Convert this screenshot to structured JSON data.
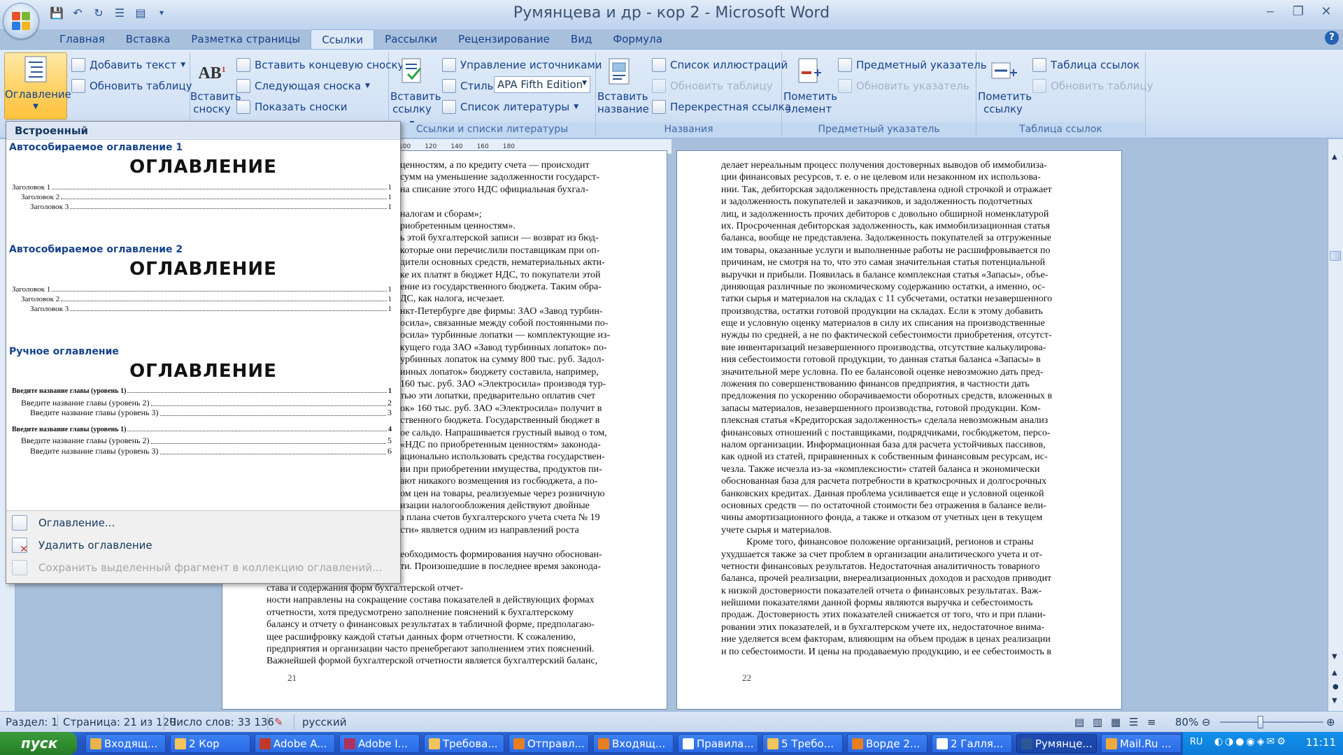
{
  "window": {
    "title": "Румянцева и др - кор 2 - Microsoft Word"
  },
  "tabs": [
    "Главная",
    "Вставка",
    "Разметка страницы",
    "Ссылки",
    "Рассылки",
    "Рецензирование",
    "Вид",
    "Формула"
  ],
  "active_tab": "Ссылки",
  "ribbon": {
    "toc_button": "Оглавление",
    "add_text": "Добавить текст",
    "update_table": "Обновить таблицу",
    "insert_footnote_1": "Вставить",
    "insert_footnote_2": "сноску",
    "insert_endnote": "Вставить концевую сноску",
    "next_footnote": "Следующая сноска",
    "show_notes": "Показать сноски",
    "insert_citation_1": "Вставить",
    "insert_citation_2": "ссылку",
    "manage_sources": "Управление источниками",
    "style_label": "Стиль:",
    "style_value": "APA Fifth Edition",
    "bibliography": "Список литературы",
    "group_citations": "Ссылки и списки литературы",
    "insert_caption_1": "Вставить",
    "insert_caption_2": "название",
    "table_of_figures": "Список иллюстраций",
    "update_table_2": "Обновить таблицу",
    "cross_reference": "Перекрестная ссылка",
    "group_captions": "Названия",
    "mark_entry_1": "Пометить",
    "mark_entry_2": "элемент",
    "insert_index": "Предметный указатель",
    "update_index": "Обновить указатель",
    "group_index": "Предметный указатель",
    "mark_citation_1": "Пометить",
    "mark_citation_2": "ссылку",
    "table_of_authorities": "Таблица ссылок",
    "update_table_3": "Обновить таблицу",
    "group_toa": "Таблица ссылок"
  },
  "gallery": {
    "header": "Встроенный",
    "sections": [
      {
        "title": "Автособираемое оглавление 1",
        "heading": "ОГЛАВЛЕНИЕ",
        "lines": [
          {
            "t": "Заголовок 1",
            "p": "1"
          },
          {
            "t": "Заголовок 2",
            "p": "1"
          },
          {
            "t": "Заголовок 3",
            "p": "1"
          }
        ]
      },
      {
        "title": "Автособираемое оглавление 2",
        "heading": "ОГЛАВЛЕНИЕ",
        "lines": [
          {
            "t": "Заголовок 1",
            "p": "1"
          },
          {
            "t": "Заголовок 2",
            "p": "1"
          },
          {
            "t": "Заголовок 3",
            "p": "1"
          }
        ]
      },
      {
        "title": "Ручное оглавление",
        "heading": "ОГЛАВЛЕНИЕ",
        "lines": [
          {
            "t": "Введите название главы (уровень 1)",
            "p": "1"
          },
          {
            "t": "Введите название главы (уровень 2)",
            "p": "2"
          },
          {
            "t": "Введите название главы (уровень 3)",
            "p": "3"
          },
          {
            "t": "Введите название главы (уровень 1)",
            "p": "4"
          },
          {
            "t": "Введите название главы (уровень 2)",
            "p": "5"
          },
          {
            "t": "Введите название главы (уровень 3)",
            "p": "6"
          }
        ]
      }
    ],
    "footer": {
      "toc_dialog": "Оглавление...",
      "remove_toc": "Удалить оглавление",
      "save_selection": "Сохранить выделенный фрагмент в коллекцию оглавлений..."
    }
  },
  "ruler_marks": [
    "100",
    "120",
    "140",
    "160",
    "180"
  ],
  "page_left": {
    "number": "21",
    "lines_top": [
      "ценностям, а по кредиту счета — происходит",
      "сумм на уменьшение задолженности государст-",
      "на списание этого НДС официальная бухгал-",
      "",
      "налогам и сборам»;",
      "риобретенным ценностям».",
      "ь этой бухгалтерской записи — возврат из бюд-",
      "которые они перечислили поставщикам при оп-",
      "дители основных средств, нематериальных акти-",
      "ке их платят в бюджет НДС, то покупатели этой",
      "ение из государственного бюджета. Таким обра-",
      "ДС, как налога, исчезает.",
      "нкт-Петербурге две фирмы: ЗАО «Завод турбин-",
      "осила», связанные между собой постоянными по-",
      "осила» турбинные лопатки — комплектующие из-",
      "кущего года ЗАО «Завод турбинных лопаток» по-",
      "урбинных лопаток на сумму 800 тыс. руб. Задол-",
      "инных лопаток» бюджету составила, например,",
      "160 тыс. руб. ЗАО «Электросила» производя тур-",
      "тью эти лопатки, предварительно оплатив счет",
      "ок» 160 тыс. руб. ЗАО «Электросила» получит в",
      "ственного бюджета. Государственный бюджет в",
      "ое сальдо. Напрашивается грустный вывод о том,",
      "«НДС по приобретенным ценностям» законода-",
      "ационально использовать средства государствен-",
      "ии при приобретении имущества, продуктов пи-",
      "ают никакого возмещения из госбюджета, а по-",
      "ом цен на товары, реализуемые через розничную",
      "изации налогообложения действуют двойные",
      "з плана счетов бухгалтерского учета счета № 19",
      "сти» является одним из направлений роста",
      "",
      "еобходимость формирования научно обоснован-",
      "ти. Произошедшие в последнее время законода-"
    ],
    "lines_bottom": [
      "става и содержания форм бухгалтерской отчет-",
      "ности направлены на сокращение состава показателей в действующих формах",
      "отчетности, хотя предусмотрено заполнение пояснений к бухгалтерскому",
      "балансу и отчету о финансовых результатах в табличной форме, предполагаю-",
      "щее расшифровку каждой статьи данных форм отчетности. К сожалению,",
      "предприятия и организации часто пренебрегают заполнением этих пояснений.",
      "Важнейшей формой бухгалтерской отчетности является бухгалтерский баланс,"
    ]
  },
  "page_right": {
    "number": "22",
    "lines": [
      "делает нереальным процесс получения достоверных выводов об иммобилиза-",
      "ции финансовых ресурсов, т. е. о не целевом или незаконном их использова-",
      "нии. Так, дебиторская задолженность представлена одной строчкой и отражает",
      "и задолженность покупателей и заказчиков, и задолженность подотчетных",
      "лиц, и задолженность прочих дебиторов с довольно обширной номенклатурой",
      "их. Просроченная дебиторская задолженность, как иммобилизационная статья",
      "баланса, вообще не представлена. Задолженность покупателей за отгруженные",
      "им товары, оказанные услуги и выполненные работы не расшифровывается по",
      "причинам, не смотря на то, что это самая значительная статья потенциальной",
      "выручки и прибыли. Появилась в балансе комплексная статья «Запасы», объе-",
      "диняющая различные по экономическому содержанию остатки, а именно, ос-",
      "татки сырья и материалов на складах с 11 субсчетами, остатки незавершенного",
      "производства, остатки готовой продукции на складах. Если к этому добавить",
      "еще и условную оценку материалов в силу их списания на производственные",
      "нужды по средней, а не по фактической себестоимости приобретения, отсутст-",
      "вие инвентаризаций незавершенного производства, отсутствие калькулирова-",
      "ния себестоимости готовой продукции, то данная статья баланса «Запасы» в",
      "значительной мере условна. По ее балансовой оценке невозможно дать пред-",
      "ложения по совершенствованию финансов предприятия, в частности дать",
      "предложения по ускорению оборачиваемости оборотных средств, вложенных в",
      "запасы материалов, незавершенного производства, готовой продукции. Ком-",
      "плексная статья «Кредиторская задолженность» сделала невозможным анализ",
      "финансовых отношений с поставщиками, подрядчиками, госбюджетом, персо-",
      "налом организации. Информационная база для расчета устойчивых пассивов,",
      "как одной из статей, приравненных к собственным финансовым ресурсам, ис-",
      "чезла. Также исчезла из-за «комплексности» статей баланса и экономически",
      "обоснованная база для расчета потребности в краткосрочных и долгосрочных",
      "банковских кредитах. Данная проблема усиливается еще и условной оценкой",
      "основных средств — по остаточной стоимости без отражения в балансе вели-",
      "чины амортизационного фонда, а также и отказом от учетных цен в текущем",
      "учете сырья и материалов.",
      "Кроме того, финансовое положение организаций, регионов и страны",
      "ухудшается также за счет проблем в организации аналитического учета и от-",
      "четности финансовых результатов. Недостаточная аналитичность товарного",
      "баланса, прочей реализации, внереализационных доходов и расходов приводит",
      "к низкой достоверности показателей отчета о финансовых результатах. Важ-",
      "нейшими показателями данной формы являются выручка и себестоимость",
      "продаж. Достоверность этих показателей снижается от того, что и при плани-",
      "ровании этих показателей, и в бухгалтерском учете их, недостаточное внима-",
      "ние уделяется всем факторам, влияющим на объем продаж в ценах реализации",
      "и по себестоимости. И цены на продаваемую продукцию, и ее себестоимость в"
    ]
  },
  "status": {
    "section": "Раздел: 1",
    "page": "Страница: 21 из 120",
    "words": "Число слов: 33 136",
    "language": "русский",
    "zoom": "80%"
  },
  "taskbar": {
    "start": "пуск",
    "items": [
      "Входящ...",
      "2 Кор",
      "Adobe A...",
      "Adobe I...",
      "Требова...",
      "Отправл...",
      "Входящ...",
      "Правила...",
      "5 Требо...",
      "Ворде 2...",
      "2 Галля...",
      "Румянце...",
      "Mail.Ru ..."
    ],
    "item_colors": [
      "#e8b44a",
      "#f2c45a",
      "#c0392b",
      "#b03060",
      "#f2c45a",
      "#e67e22",
      "#e67e22",
      "#ffffff",
      "#f2c45a",
      "#e67e22",
      "#ffffff",
      "#2b5797",
      "#f2a93b"
    ],
    "lang": "RU",
    "clock": "11:11"
  }
}
